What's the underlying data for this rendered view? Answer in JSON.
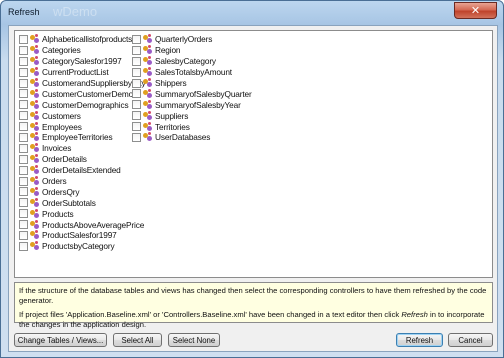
{
  "window": {
    "title": "Refresh",
    "ghost_title": "wDemo",
    "close_symbol": "✕"
  },
  "controllers": {
    "column1": [
      {
        "label": "Alphabeticallistofproducts",
        "checked": false
      },
      {
        "label": "Categories",
        "checked": false
      },
      {
        "label": "CategorySalesfor1997",
        "checked": false
      },
      {
        "label": "CurrentProductList",
        "checked": false
      },
      {
        "label": "CustomerandSuppliersbyCity",
        "checked": false
      },
      {
        "label": "CustomerCustomerDemo",
        "checked": false
      },
      {
        "label": "CustomerDemographics",
        "checked": false
      },
      {
        "label": "Customers",
        "checked": false
      },
      {
        "label": "Employees",
        "checked": false
      },
      {
        "label": "EmployeeTerritories",
        "checked": false
      },
      {
        "label": "Invoices",
        "checked": false
      },
      {
        "label": "OrderDetails",
        "checked": false
      },
      {
        "label": "OrderDetailsExtended",
        "checked": false
      },
      {
        "label": "Orders",
        "checked": false
      },
      {
        "label": "OrdersQry",
        "checked": false
      },
      {
        "label": "OrderSubtotals",
        "checked": false
      },
      {
        "label": "Products",
        "checked": false
      },
      {
        "label": "ProductsAboveAveragePrice",
        "checked": false
      },
      {
        "label": "ProductSalesfor1997",
        "checked": false
      },
      {
        "label": "ProductsbyCategory",
        "checked": false
      }
    ],
    "column2": [
      {
        "label": "QuarterlyOrders",
        "checked": false
      },
      {
        "label": "Region",
        "checked": false
      },
      {
        "label": "SalesbyCategory",
        "checked": false
      },
      {
        "label": "SalesTotalsbyAmount",
        "checked": false
      },
      {
        "label": "Shippers",
        "checked": false
      },
      {
        "label": "SummaryofSalesbyQuarter",
        "checked": false
      },
      {
        "label": "SummaryofSalesbyYear",
        "checked": false
      },
      {
        "label": "Suppliers",
        "checked": false
      },
      {
        "label": "Territories",
        "checked": false
      },
      {
        "label": "UserDatabases",
        "checked": false
      }
    ]
  },
  "info": {
    "line1": "If the structure of the database tables and views has changed then select the corresponding controllers to have them refreshed by the code generator.",
    "line2_prefix": "If project files 'Application.Baseline.xml' or 'Controllers.Baseline.xml' have been changed in a text editor then click ",
    "line2_emphasis": "Refresh",
    "line2_suffix": " in to incorporate the changes in the application design."
  },
  "buttons": {
    "change_tables": "Change Tables / Views...",
    "select_all": "Select All",
    "select_none": "Select None",
    "refresh": "Refresh",
    "cancel": "Cancel"
  }
}
